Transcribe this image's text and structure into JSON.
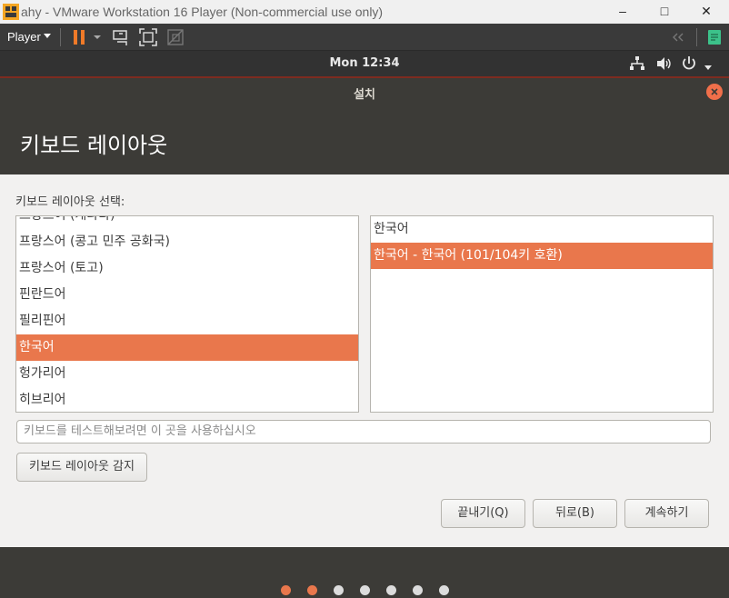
{
  "vmware": {
    "title": "ahy - VMware Workstation 16 Player (Non-commercial use only)",
    "player_menu": "Player",
    "minimize": "–",
    "maximize": "□",
    "close": "✕"
  },
  "gnome": {
    "clock": "Mon 12:34"
  },
  "installer": {
    "window_title": "설치",
    "heading": "키보드 레이아웃",
    "layout_label": "키보드 레이아웃 선택:",
    "layouts": [
      {
        "label": "프랑스어 (캐나다)"
      },
      {
        "label": "프랑스어 (콩고 민주 공화국)"
      },
      {
        "label": "프랑스어 (토고)"
      },
      {
        "label": "핀란드어"
      },
      {
        "label": "필리핀어"
      },
      {
        "label": "한국어",
        "selected": true
      },
      {
        "label": "헝가리어"
      },
      {
        "label": "히브리어"
      }
    ],
    "variants": [
      {
        "label": "한국어"
      },
      {
        "label": "한국어 - 한국어 (101/104키 호환)",
        "selected": true
      }
    ],
    "test_placeholder": "키보드를 테스트해보려면 이 곳을 사용하십시오",
    "detect_button": "키보드 레이아웃 감지",
    "quit_button": "끝내기(Q)",
    "back_button": "뒤로(B)",
    "continue_button": "계속하기",
    "progress": {
      "total_steps": 7,
      "completed_steps": 2
    }
  },
  "colors": {
    "accent": "#e9774c",
    "header_bg": "#3c3b37",
    "dot_active": "#e9774c",
    "dot_inactive": "#dcdcdc"
  }
}
